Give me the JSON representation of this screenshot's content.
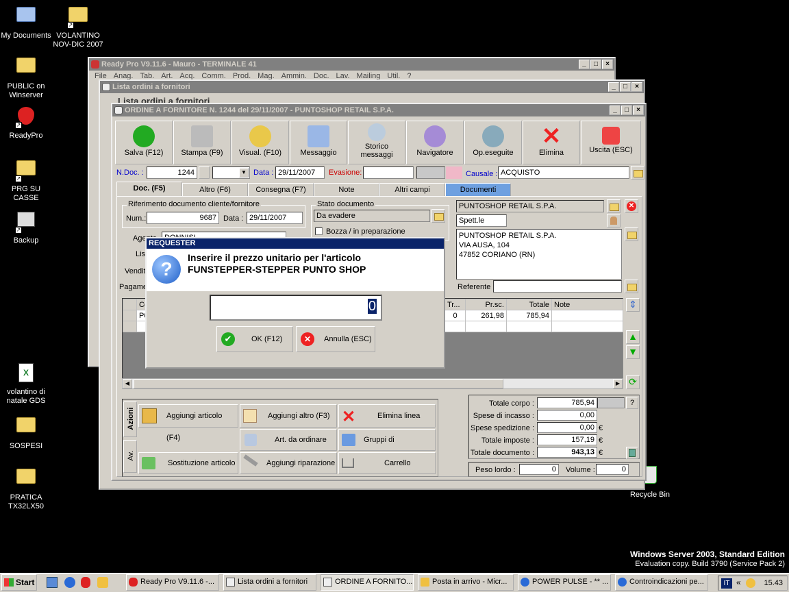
{
  "desktop": {
    "icons": [
      {
        "label": "My Documents"
      },
      {
        "label": "VOLANTINO NOV-DIC 2007"
      },
      {
        "label": "PUBLIC on Winserver"
      },
      {
        "label": "ReadyPro"
      },
      {
        "label": "PRG SU CASSE"
      },
      {
        "label": "Backup"
      },
      {
        "label": "volantino di natale GDS"
      },
      {
        "label": "SOSPESI"
      },
      {
        "label": "PRATICA TX32LX50"
      },
      {
        "label": "Recycle Bin"
      }
    ],
    "watermark_line1": "Windows Server 2003, Standard Edition",
    "watermark_line2": "Evaluation copy. Build 3790 (Service Pack 2)"
  },
  "win_main": {
    "title": "Ready Pro V9.11.6 - Mauro - TERMINALE 41",
    "menu": [
      "File",
      "Anag.",
      "Tab.",
      "Art.",
      "Acq.",
      "Comm.",
      "Prod.",
      "Mag.",
      "Ammin.",
      "Doc.",
      "Lav.",
      "Mailing",
      "Util.",
      "?"
    ]
  },
  "win_list": {
    "title": "Lista ordini a fornitori",
    "subtitle": "Lista ordini a fornitori"
  },
  "win_order": {
    "title": "ORDINE A FORNITORE N. 1244  del 29/11/2007 - PUNTOSHOP RETAIL S.P.A.",
    "toolbar": [
      {
        "label": "Salva (F12)",
        "icon": "check-icon"
      },
      {
        "label": "Stampa (F9)",
        "icon": "printer-icon"
      },
      {
        "label": "Visual. (F10)",
        "icon": "magic-wand-icon"
      },
      {
        "label": "Messaggio",
        "icon": "envelope-icon"
      },
      {
        "label": "Storico messaggi",
        "icon": "mail-history-icon"
      },
      {
        "label": "Navigatore",
        "icon": "navigator-icon"
      },
      {
        "label": "Op.eseguite",
        "icon": "gears-icon"
      },
      {
        "label": "Elimina",
        "icon": "delete-x-icon"
      },
      {
        "label": "Uscita (ESC)",
        "icon": "exit-icon"
      }
    ],
    "ndoc_label": "N.Doc. :",
    "ndoc_value": "1244",
    "data_label": "Data :",
    "data_value": "29/11/2007",
    "evasione_label": "Evasione:",
    "causale_label": "Causale :",
    "causale_value": "ACQUISTO",
    "tabs": [
      "Doc. (F5)",
      "Altro (F6)",
      "Consegna (F7)",
      "Note",
      "Altri campi",
      "Documenti"
    ],
    "rif_group": "Riferimento documento cliente/fornitore",
    "num_label": "Num.:",
    "num_value": "9687",
    "data2_label": "Data :",
    "data2_value": "29/11/2007",
    "stato_group": "Stato documento",
    "stato_value": "Da evadere",
    "bozza_label": "Bozza / in preparazione",
    "agente_label": "Agente",
    "agente_value": "DONNISI",
    "listino_label": "Listino",
    "vendita_label": "Vendita",
    "pagamento_label": "Pagamento",
    "supplier_name": "PUNTOSHOP RETAIL S.P.A.",
    "spett_value": "Spett.le",
    "address": [
      "PUNTOSHOP RETAIL S.P.A.",
      "VIA AUSA, 104",
      "47852 CORIANO (RN)"
    ],
    "referente_label": "Referente",
    "grid_headers": [
      "Co",
      "Tr...",
      "Pr.sc.",
      "Totale",
      "Note"
    ],
    "grid_row": {
      "code": "P0",
      "tr": "0",
      "prsc": "261,98",
      "totale": "785,94",
      "note": ""
    },
    "actions_tab": "Azioni",
    "av_tab": "Av.",
    "actions": [
      {
        "label": "Aggiungi articolo (F4)",
        "icon": "add-box-icon"
      },
      {
        "label": "Aggiungi altro (F3)",
        "icon": "add-grid-icon"
      },
      {
        "label": "Elimina linea",
        "icon": "delete-x-icon"
      },
      {
        "label": "Art. da ordinare",
        "icon": "order-item-icon"
      },
      {
        "label": "Gruppi di inserimento",
        "icon": "group-insert-icon"
      },
      {
        "label": "Sostituzione articolo",
        "icon": "replace-icon"
      },
      {
        "label": "Aggiungi riparazione",
        "icon": "wrench-icon"
      },
      {
        "label": "Carrello",
        "icon": "cart-icon"
      }
    ],
    "totals": [
      {
        "label": "Totale corpo :",
        "value": "785,94",
        "unit": ""
      },
      {
        "label": "Spese di incasso :",
        "value": "0,00",
        "unit": ""
      },
      {
        "label": "Spese spedizione :",
        "value": "0,00",
        "unit": "€"
      },
      {
        "label": "Totale imposte :",
        "value": "157,19",
        "unit": "€"
      },
      {
        "label": "Totale documento :",
        "value": "943,13",
        "unit": "€"
      }
    ],
    "peso_label": "Peso lordo :",
    "peso_value": "0",
    "volume_label": "Volume :",
    "volume_value": "0"
  },
  "dialog": {
    "title": "REQUESTER",
    "message_line1": "Inserire il prezzo unitario per l'articolo",
    "message_line2": "FUNSTEPPER-STEPPER PUNTO SHOP",
    "input_value": "0",
    "ok_label": "OK (F12)",
    "cancel_label": "Annulla (ESC)"
  },
  "taskbar": {
    "start_label": "Start",
    "tasks": [
      "Ready Pro V9.11.6 -...",
      "Lista ordini a fornitori",
      "ORDINE A FORNITO...",
      "Posta in arrivo - Micr...",
      "POWER PULSE - ** ...",
      "Controindicazioni pe..."
    ],
    "lang": "IT",
    "clock": "15.43"
  }
}
